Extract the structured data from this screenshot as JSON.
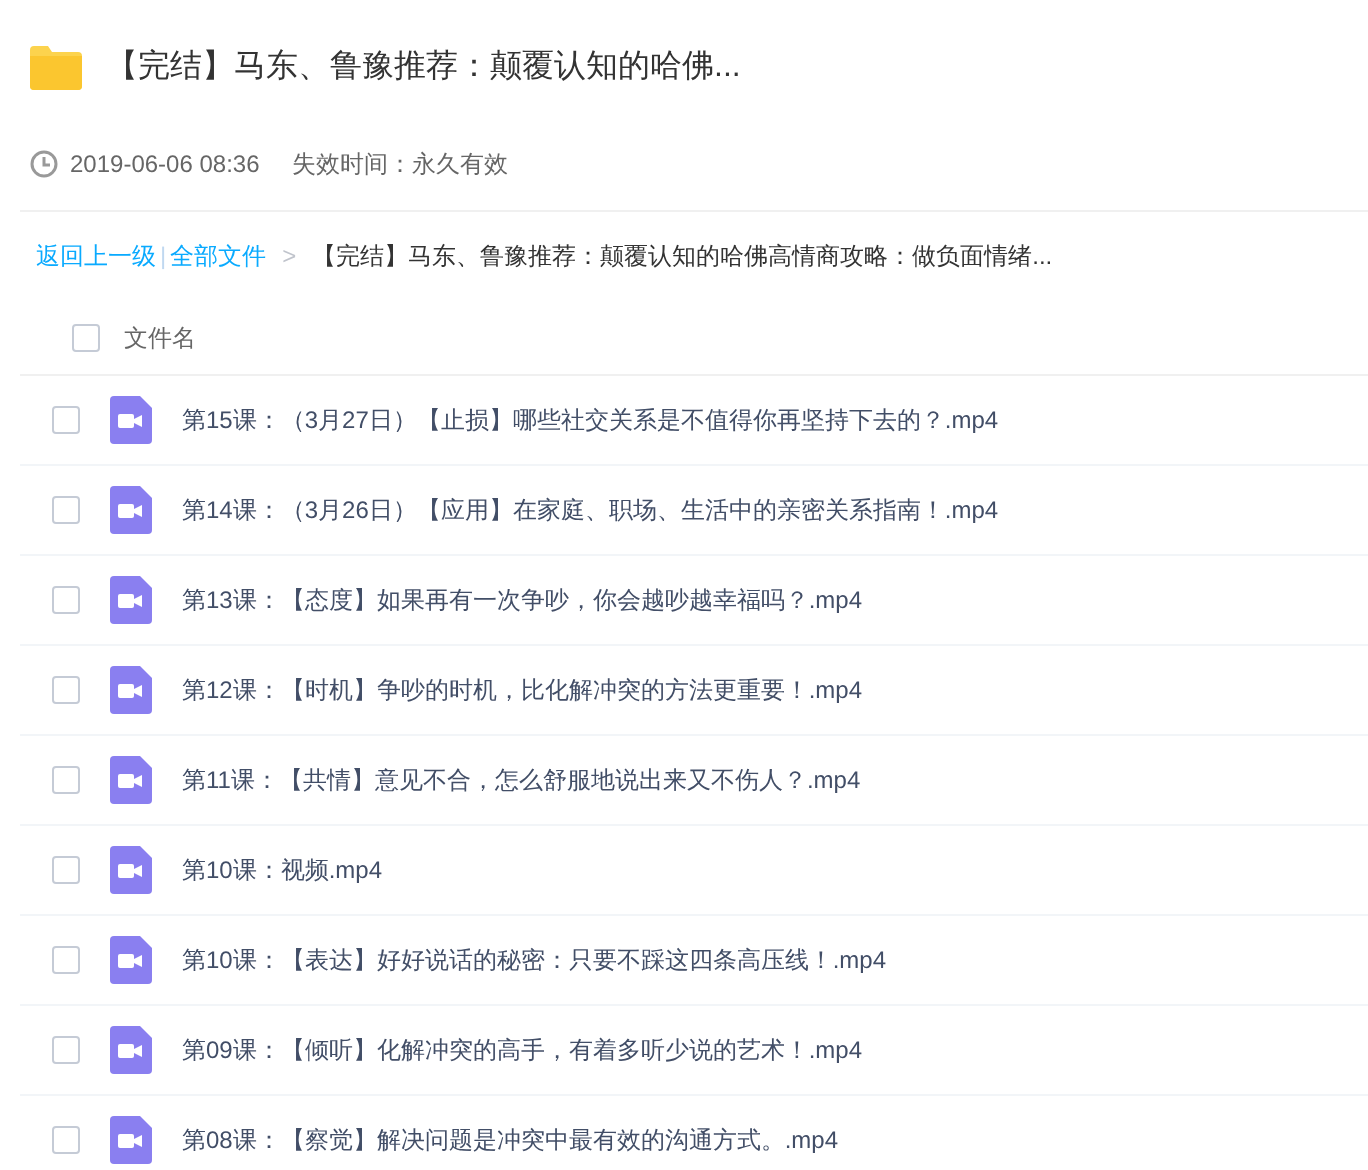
{
  "folder": {
    "title": "【完结】马东、鲁豫推荐：颠覆认知的哈佛..."
  },
  "meta": {
    "date": "2019-06-06 08:36",
    "expiry": "失效时间：永久有效"
  },
  "breadcrumb": {
    "back": "返回上一级",
    "separator": "|",
    "root": "全部文件",
    "arrow": ">",
    "current": "【完结】马东、鲁豫推荐：颠覆认知的哈佛高情商攻略：做负面情绪..."
  },
  "header": {
    "label": "文件名",
    "checked": false
  },
  "files": [
    {
      "name": "第15课：（3月27日）【止损】哪些社交关系是不值得你再坚持下去的？.mp4",
      "checked": false
    },
    {
      "name": "第14课：（3月26日）【应用】在家庭、职场、生活中的亲密关系指南！.mp4",
      "checked": false
    },
    {
      "name": "第13课：【态度】如果再有一次争吵，你会越吵越幸福吗？.mp4",
      "checked": false
    },
    {
      "name": "第12课：【时机】争吵的时机，比化解冲突的方法更重要！.mp4",
      "checked": false
    },
    {
      "name": "第11课：【共情】意见不合，怎么舒服地说出来又不伤人？.mp4",
      "checked": false
    },
    {
      "name": "第10课：视频.mp4",
      "checked": false
    },
    {
      "name": "第10课：【表达】好好说话的秘密：只要不踩这四条高压线！.mp4",
      "checked": false
    },
    {
      "name": "第09课：【倾听】化解冲突的高手，有着多听少说的艺术！.mp4",
      "checked": false
    },
    {
      "name": "第08课：【察觉】解决问题是冲突中最有效的沟通方式。.mp4",
      "checked": false
    }
  ]
}
